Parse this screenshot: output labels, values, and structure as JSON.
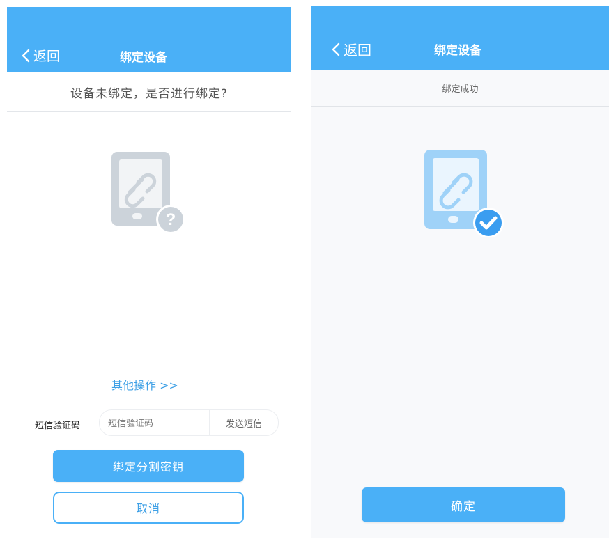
{
  "left_screen": {
    "nav": {
      "back_label": "返回",
      "title": "绑定设备"
    },
    "prompt": "设备未绑定，是否进行绑定?",
    "other_actions": "其他操作 >>",
    "sms": {
      "label": "短信验证码",
      "placeholder": "短信验证码",
      "send_label": "发送短信"
    },
    "bind_button": "绑定分割密钥",
    "cancel_button": "取消"
  },
  "right_screen": {
    "nav": {
      "back_label": "返回",
      "title": "绑定设备"
    },
    "status": "绑定成功",
    "confirm_button": "确定"
  },
  "icons": {
    "back": "chevron-left-icon",
    "unbound": "phone-link-question-icon",
    "bound": "phone-link-check-icon"
  },
  "colors": {
    "primary": "#4ab0f7",
    "link": "#3ea0e6",
    "illustration_gray": "#ccd3da",
    "illustration_blue": "#9fd2f8",
    "check_badge": "#3a9df0"
  }
}
